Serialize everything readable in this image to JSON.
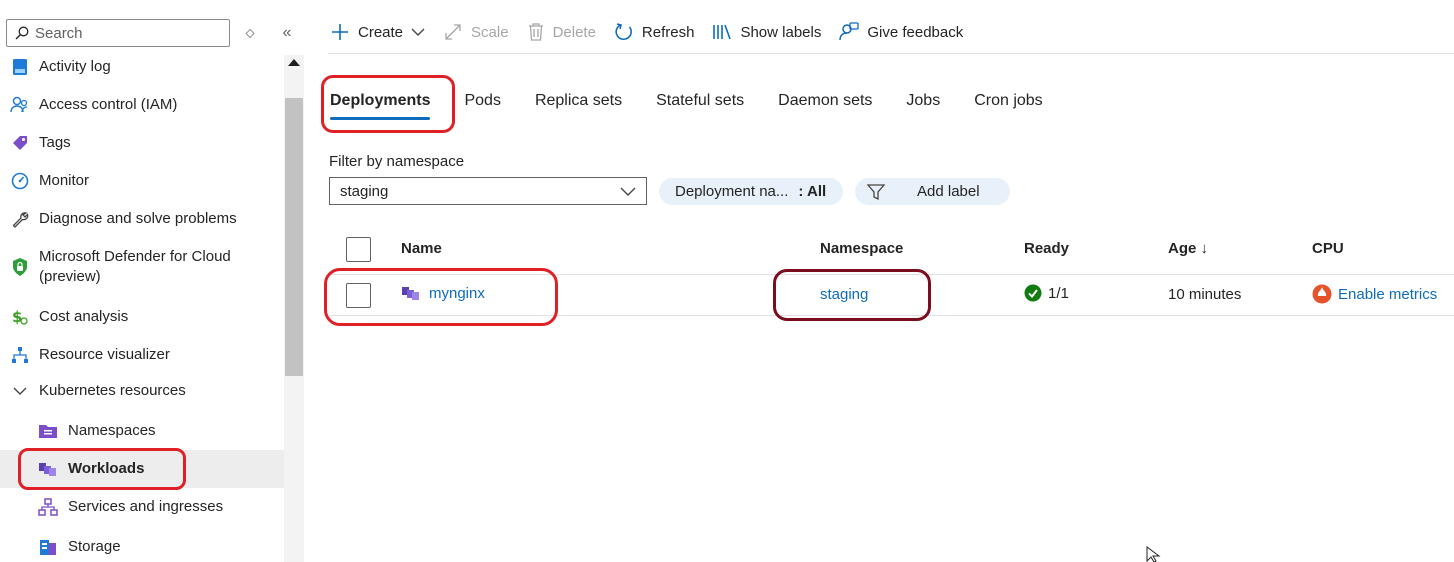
{
  "sidebar": {
    "search_placeholder": "Search",
    "items": [
      {
        "label": "Activity log",
        "icon": "activity-log-icon"
      },
      {
        "label": "Access control (IAM)",
        "icon": "people-icon"
      },
      {
        "label": "Tags",
        "icon": "tag-icon"
      },
      {
        "label": "Monitor",
        "icon": "gauge-icon"
      },
      {
        "label": "Diagnose and solve problems",
        "icon": "wrench-icon"
      },
      {
        "label": "Microsoft Defender for Cloud\n(preview)",
        "icon": "shield-icon"
      },
      {
        "label": "Cost analysis",
        "icon": "dollar-icon"
      },
      {
        "label": "Resource visualizer",
        "icon": "hierarchy-icon"
      },
      {
        "label": "Kubernetes resources",
        "icon": "chevron-down-icon"
      },
      {
        "label": "Namespaces",
        "icon": "namespace-icon"
      },
      {
        "label": "Workloads",
        "icon": "workloads-icon"
      },
      {
        "label": "Services and ingresses",
        "icon": "services-icon"
      },
      {
        "label": "Storage",
        "icon": "storage-icon"
      }
    ]
  },
  "toolbar": {
    "create": "Create",
    "scale": "Scale",
    "delete": "Delete",
    "refresh": "Refresh",
    "show_labels": "Show labels",
    "give_feedback": "Give feedback"
  },
  "tabs": [
    "Deployments",
    "Pods",
    "Replica sets",
    "Stateful sets",
    "Daemon sets",
    "Jobs",
    "Cron jobs"
  ],
  "filters": {
    "label": "Filter by namespace",
    "namespace_value": "staging",
    "deployment_pill_label": "Deployment na...",
    "deployment_pill_value": ": All",
    "add_label": "Add label"
  },
  "table": {
    "headers": {
      "name": "Name",
      "namespace": "Namespace",
      "ready": "Ready",
      "age": "Age ↓",
      "cpu": "CPU"
    },
    "rows": [
      {
        "name": "mynginx",
        "namespace": "staging",
        "ready": "1/1",
        "age": "10 minutes",
        "cpu": "Enable metrics"
      }
    ]
  },
  "colors": {
    "accent": "#0f6cbd",
    "annotation": "#e02027",
    "annotation_dark": "#7a0d1e",
    "ok_green": "#107c10"
  }
}
